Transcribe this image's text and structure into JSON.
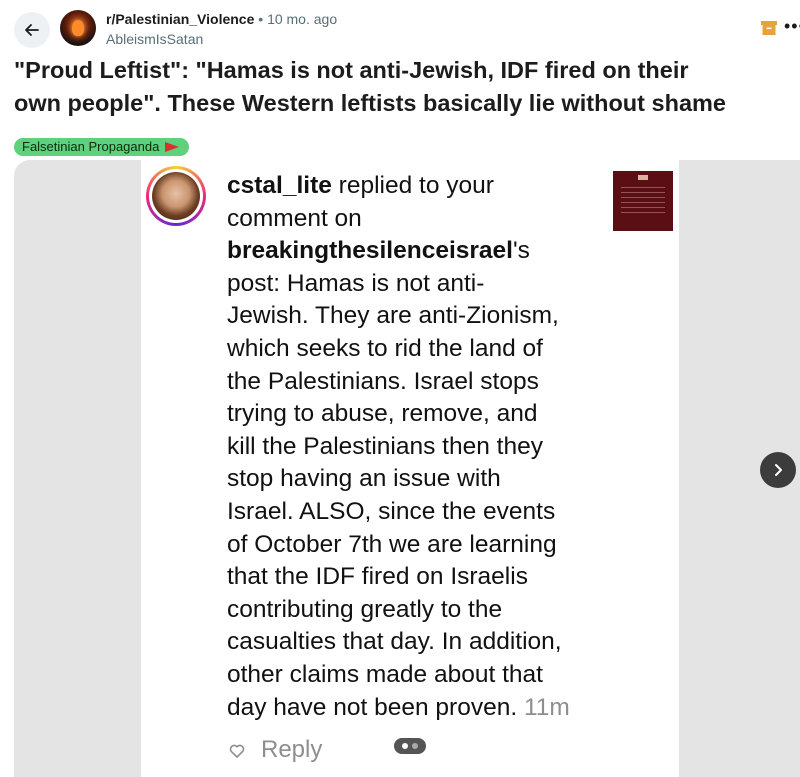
{
  "header": {
    "subreddit": "r/Palestinian_Violence",
    "separator": "•",
    "time": "10 mo. ago",
    "author": "AbleismIsSatan"
  },
  "post": {
    "title_lines": [
      "\"Proud Leftist\": \"Hamas is not anti-Jewish, IDF fired on their",
      "own people\". These Western leftists basically lie without shame"
    ],
    "flair": "Falsetinian Propaganda"
  },
  "screenshot": {
    "username": "cstal_lite",
    "lines": [
      " replied to your",
      "comment on",
      "breakingthesilenceisrael",
      "'s",
      "post: Hamas is not anti-",
      "Jewish. They are anti-Zionism,",
      "which seeks to rid the land of",
      "the Palestinians. Israel stops",
      "trying to abuse, remove, and",
      "kill the Palestinians then they",
      "stop having an issue with",
      "Israel. ALSO, since the events",
      "of October 7th we are learning",
      "that the IDF fired on Israelis",
      "contributing greatly to the",
      "casualties that day. In addition,",
      "other claims made about that",
      "day have not been proven. "
    ],
    "timestamp": "11m",
    "reply_label": "Reply"
  },
  "icons": {
    "back": "arrow-left-icon",
    "archive": "archive-icon",
    "more": "more-horizontal-icon",
    "heart": "heart-icon",
    "next": "chevron-right-icon"
  },
  "colors": {
    "flair_bg": "#5fd17a",
    "archive": "#e6a23c",
    "thumb_bg": "#5b0f14"
  }
}
